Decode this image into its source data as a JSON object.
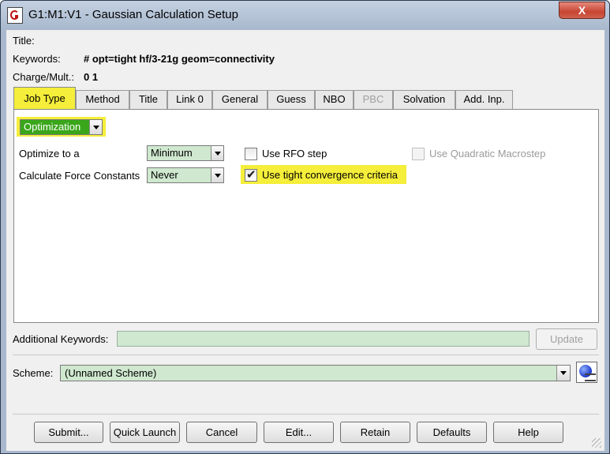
{
  "window": {
    "title": "G1:M1:V1 - Gaussian Calculation Setup",
    "close_label": "X"
  },
  "header": {
    "title_label": "Title:",
    "keywords_label": "Keywords:",
    "keywords_value": "# opt=tight hf/3-21g geom=connectivity",
    "charge_label": "Charge/Mult.:",
    "charge_value": "0 1"
  },
  "tabs": [
    {
      "label": "Job Type",
      "active": true
    },
    {
      "label": "Method"
    },
    {
      "label": "Title"
    },
    {
      "label": "Link 0"
    },
    {
      "label": "General"
    },
    {
      "label": "Guess"
    },
    {
      "label": "NBO"
    },
    {
      "label": "PBC",
      "disabled": true
    },
    {
      "label": "Solvation"
    },
    {
      "label": "Add. Inp."
    }
  ],
  "job_type": {
    "selected": "Optimization",
    "optimize_to_label": "Optimize to a",
    "optimize_to_value": "Minimum",
    "force_constants_label": "Calculate Force Constants",
    "force_constants_value": "Never",
    "rfo_label": "Use RFO step",
    "tight_label": "Use tight convergence criteria",
    "quadratic_label": "Use Quadratic Macrostep"
  },
  "additional_keywords": {
    "label": "Additional Keywords:",
    "value": "",
    "update_label": "Update"
  },
  "scheme": {
    "label": "Scheme:",
    "value": "(Unnamed Scheme)"
  },
  "buttons": {
    "submit": "Submit...",
    "quick_launch": "Quick Launch",
    "cancel": "Cancel",
    "edit": "Edit...",
    "retain": "Retain",
    "defaults": "Defaults",
    "help": "Help"
  },
  "colors": {
    "highlight": "#f5ee3a",
    "field_green": "#cfe8cf",
    "combo_green": "#3aa61a"
  }
}
